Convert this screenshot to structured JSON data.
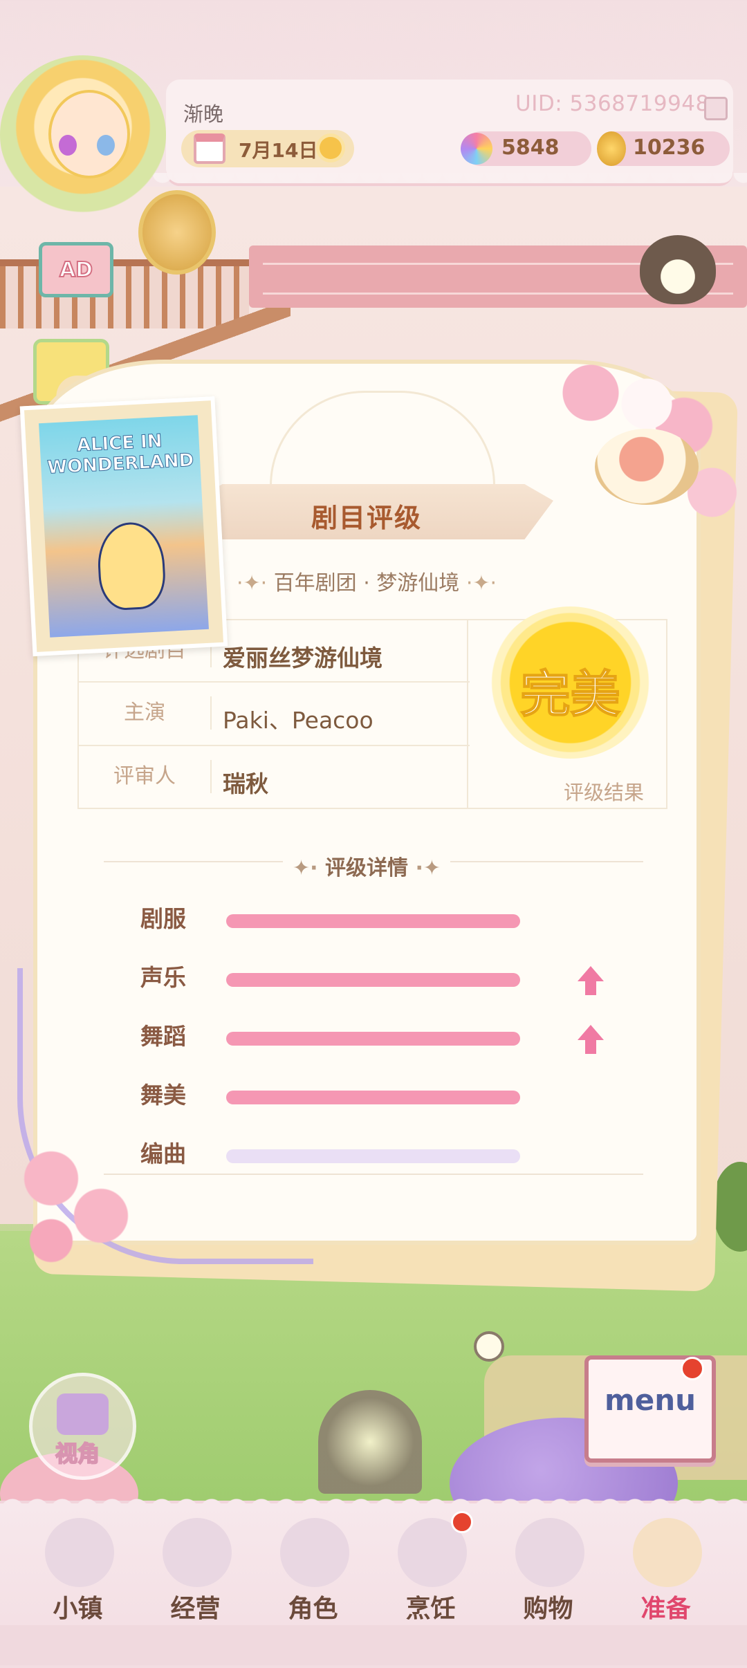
{
  "header": {
    "player_name": "渐晚",
    "uid": "UID: 5368719948",
    "date": "7月14日",
    "gems": "5848",
    "coins": "10236",
    "ad_label": "AD"
  },
  "card": {
    "title": "剧目评级",
    "subtitle": "百年剧团 · 梦游仙境",
    "info": [
      {
        "label": "评选剧目",
        "value": "爱丽丝梦游仙境"
      },
      {
        "label": "主演",
        "value": "Paki、Peacoo"
      },
      {
        "label": "评审人",
        "value": "瑞秋"
      }
    ],
    "result_medal": "完美",
    "result_label": "评级结果",
    "alice_title": "ALICE IN WONDERLAND",
    "details_title": "评级详情",
    "stats": [
      {
        "label": "剧服",
        "fill": 1.0,
        "color": "#f597b3",
        "up": false
      },
      {
        "label": "声乐",
        "fill": 1.0,
        "color": "#f597b3",
        "up": true
      },
      {
        "label": "舞蹈",
        "fill": 1.0,
        "color": "#f597b3",
        "up": true
      },
      {
        "label": "舞美",
        "fill": 1.0,
        "color": "#f597b3",
        "up": false
      },
      {
        "label": "编曲",
        "fill": 1.0,
        "color": "#eadff5",
        "up": false
      }
    ]
  },
  "camera_label": "视角",
  "menu_label": "menu",
  "nav": [
    {
      "label": "小镇",
      "selected": false,
      "badge": false
    },
    {
      "label": "经营",
      "selected": false,
      "badge": false
    },
    {
      "label": "角色",
      "selected": false,
      "badge": false
    },
    {
      "label": "烹饪",
      "selected": false,
      "badge": true
    },
    {
      "label": "购物",
      "selected": false,
      "badge": false
    },
    {
      "label": "准备",
      "selected": true,
      "badge": false
    }
  ]
}
